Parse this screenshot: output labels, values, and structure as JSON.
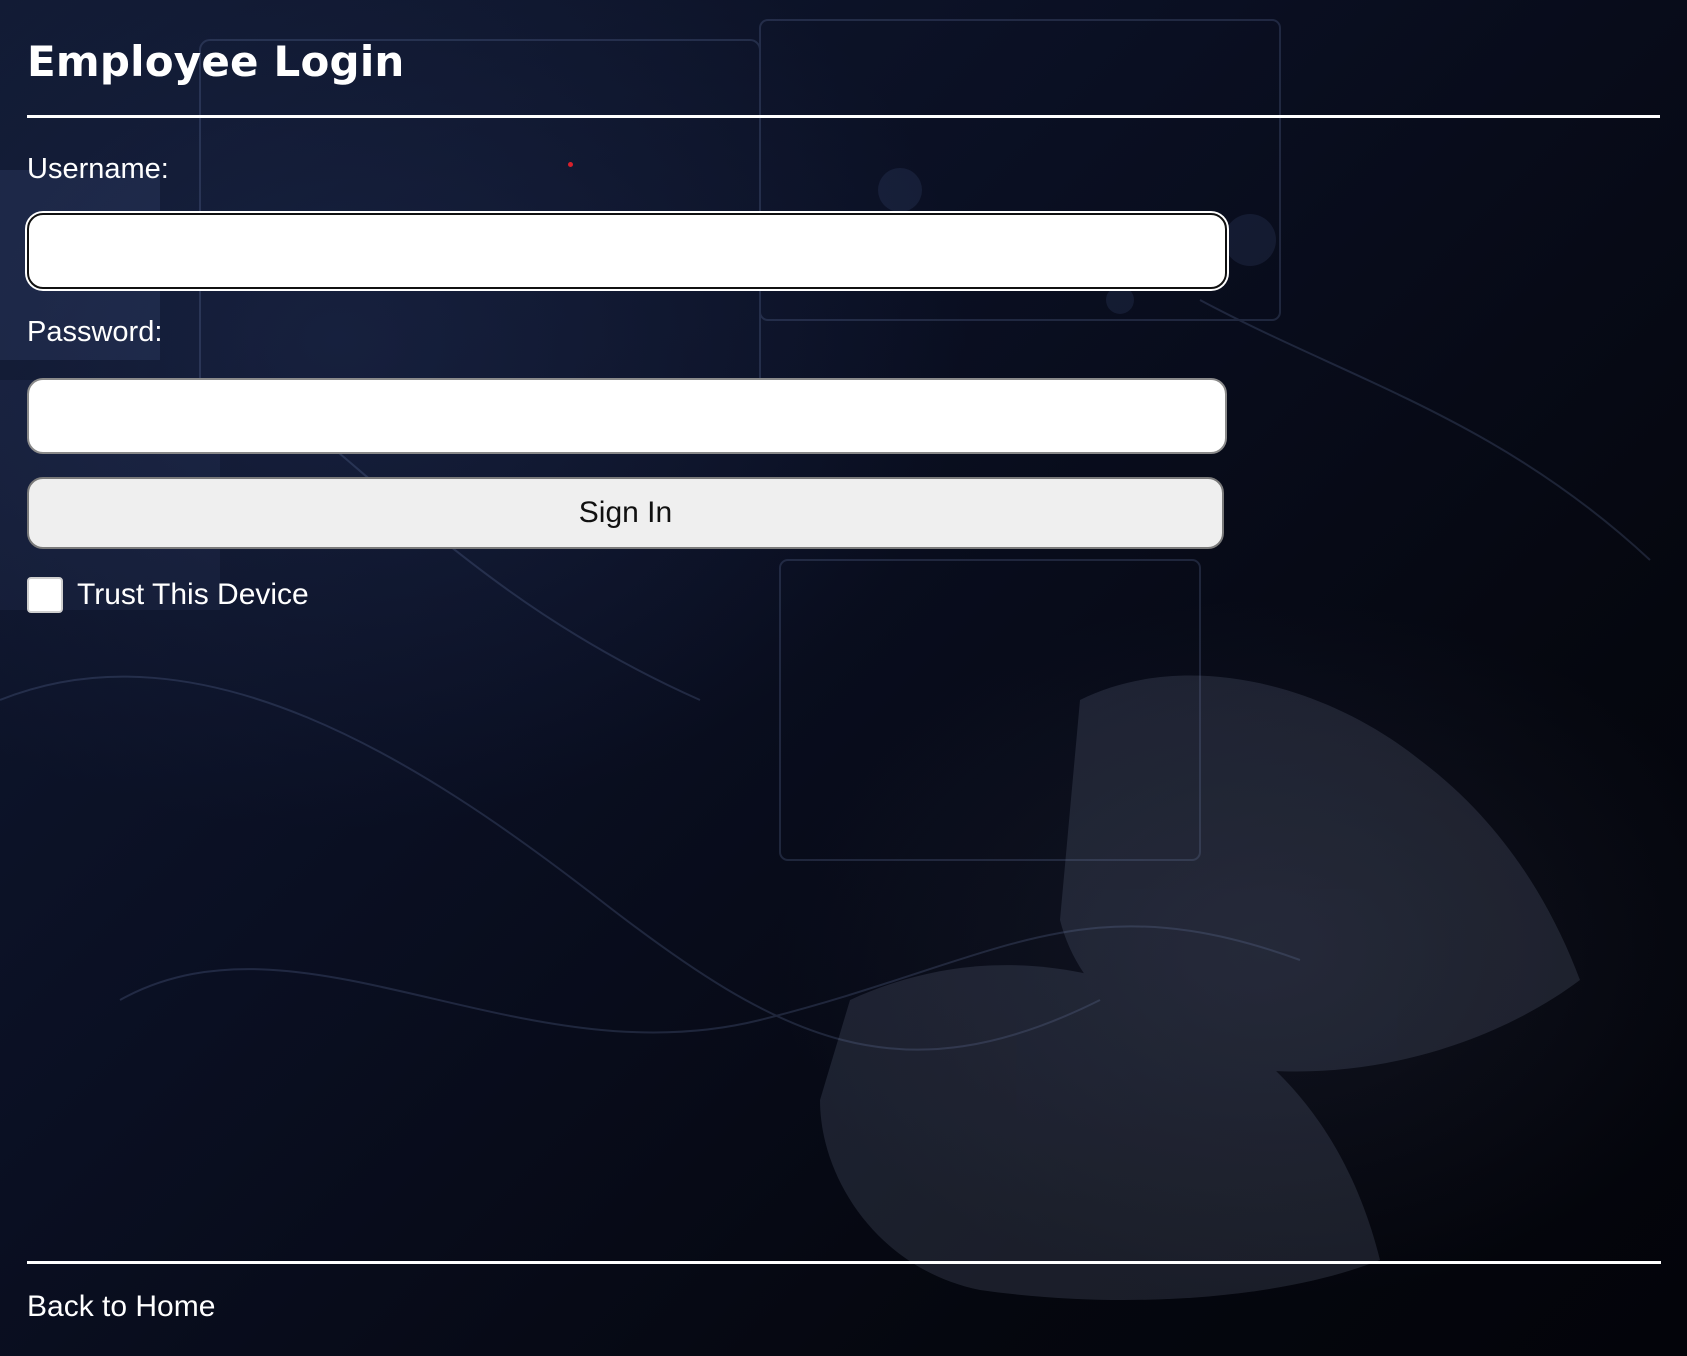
{
  "page": {
    "title": "Employee Login"
  },
  "form": {
    "username_label": "Username:",
    "username_value": "",
    "password_label": "Password:",
    "password_value": "",
    "signin_label": "Sign In",
    "trust_label": "Trust This Device",
    "trust_checked": false
  },
  "footer": {
    "back_link": "Back to Home"
  },
  "colors": {
    "background": "#05070f",
    "text": "#ffffff",
    "button_bg": "#efefef",
    "accent_dot": "#d8202b"
  },
  "icons": {
    "background": "lab-equipment-photo"
  }
}
